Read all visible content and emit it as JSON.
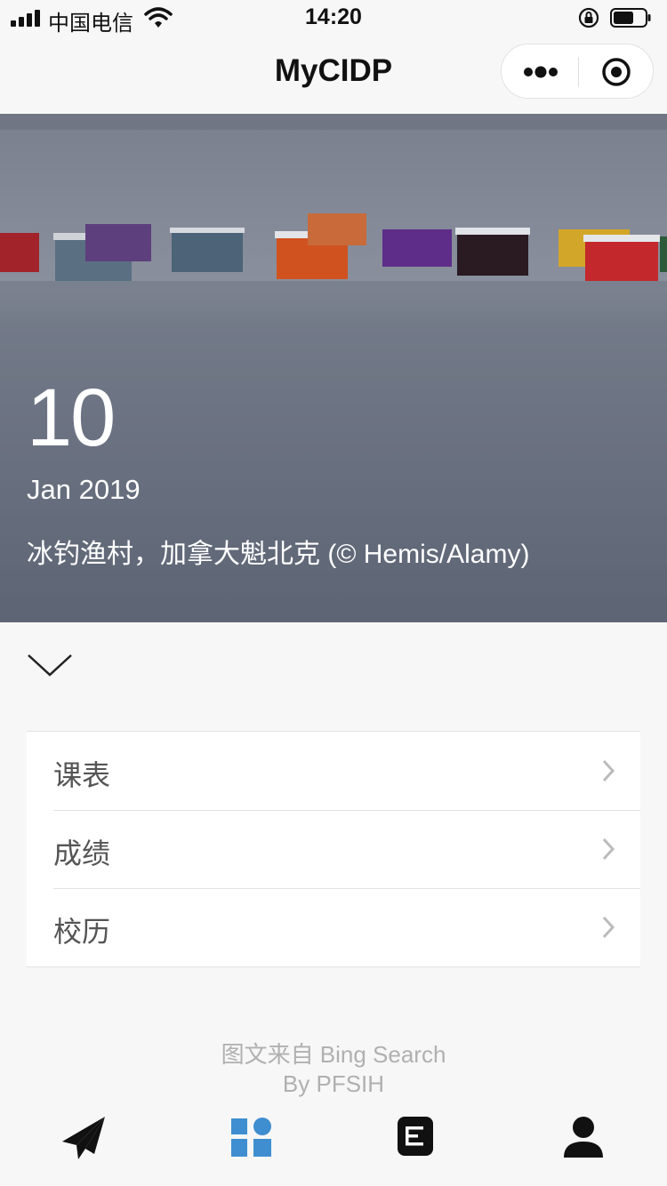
{
  "status_bar": {
    "carrier": "中国电信",
    "time": "14:20"
  },
  "nav": {
    "title": "MyCIDP"
  },
  "hero": {
    "day": "10",
    "month_year": "Jan 2019",
    "caption": "冰钓渔村，加拿大魁北克 (© Hemis/Alamy)"
  },
  "menu": {
    "items": [
      {
        "label": "课表"
      },
      {
        "label": "成绩"
      },
      {
        "label": "校历"
      }
    ]
  },
  "footer": {
    "credit_line1": "图文来自 Bing Search",
    "credit_line2": "By PFSIH"
  },
  "tab_bar": {
    "icons": [
      "paper-plane-icon",
      "dashboard-grid-icon",
      "document-icon",
      "user-icon"
    ],
    "active_color": "#3e8ed0",
    "inactive_color": "#111111"
  },
  "colors": {
    "background": "#f7f7f7",
    "hero_overlay": "#5a6172"
  }
}
